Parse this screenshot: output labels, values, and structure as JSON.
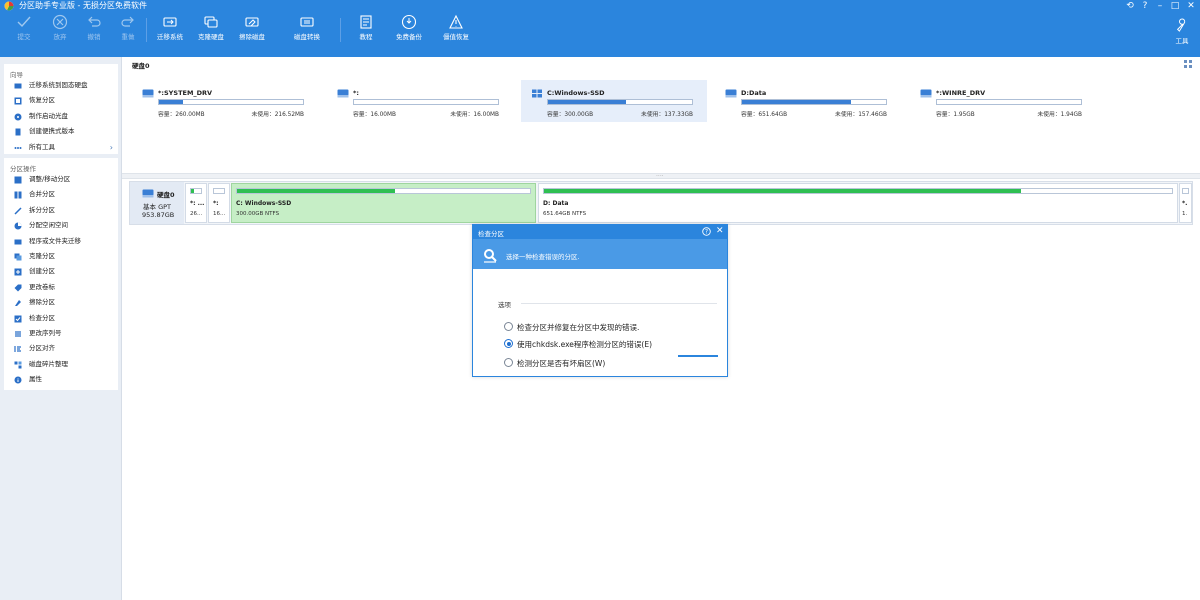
{
  "app": {
    "title": "分区助手专业版 - 无损分区免费软件",
    "window_controls": [
      "restore-icon",
      "help-icon",
      "minimize-icon",
      "maximize-icon",
      "close-icon"
    ]
  },
  "toolbar": {
    "items": [
      {
        "label": "提交",
        "icon": "check-icon",
        "enabled": false
      },
      {
        "label": "放弃",
        "icon": "cancel-icon",
        "enabled": false
      },
      {
        "label": "撤销",
        "icon": "undo-icon",
        "enabled": false
      },
      {
        "label": "重做",
        "icon": "redo-icon",
        "enabled": false
      },
      {
        "label": "迁移系统",
        "icon": "migrate-os-icon",
        "enabled": true
      },
      {
        "label": "克隆硬盘",
        "icon": "clone-disk-icon",
        "enabled": true
      },
      {
        "label": "擦除磁盘",
        "icon": "wipe-disk-icon",
        "enabled": true
      },
      {
        "label": "磁盘转换",
        "icon": "convert-disk-icon",
        "enabled": true
      },
      {
        "label": "教程",
        "icon": "tutorial-icon",
        "enabled": true
      },
      {
        "label": "免费备份",
        "icon": "backup-icon",
        "enabled": true
      },
      {
        "label": "僵值恢复",
        "icon": "recovery-icon",
        "enabled": true
      }
    ],
    "tools_label": "工具"
  },
  "sidebar": {
    "wizard_title": "向导",
    "wizard_items": [
      {
        "label": "迁移系统到固态硬盘",
        "icon": "migrate-ssd-icon"
      },
      {
        "label": "恢复分区",
        "icon": "recover-partition-icon"
      },
      {
        "label": "制作启动光盘",
        "icon": "bootable-media-icon"
      },
      {
        "label": "创建便携式版本",
        "icon": "portable-version-icon"
      },
      {
        "label": "所有工具",
        "icon": "more-tools-icon"
      }
    ],
    "ops_title": "分区操作",
    "ops_items": [
      {
        "label": "调整/移动分区",
        "icon": "resize-icon"
      },
      {
        "label": "合并分区",
        "icon": "merge-icon"
      },
      {
        "label": "拆分分区",
        "icon": "split-icon"
      },
      {
        "label": "分配空闲空间",
        "icon": "allocate-space-icon"
      },
      {
        "label": "程序或文件夹迁移",
        "icon": "app-mover-icon"
      },
      {
        "label": "克隆分区",
        "icon": "clone-partition-icon"
      },
      {
        "label": "创建分区",
        "icon": "create-partition-icon"
      },
      {
        "label": "更改卷标",
        "icon": "change-label-icon"
      },
      {
        "label": "擦除分区",
        "icon": "wipe-partition-icon"
      },
      {
        "label": "检查分区",
        "icon": "check-partition-icon"
      },
      {
        "label": "更改序列号",
        "icon": "serial-number-icon"
      },
      {
        "label": "分区对齐",
        "icon": "align-icon"
      },
      {
        "label": "磁盘碎片整理",
        "icon": "defrag-icon"
      },
      {
        "label": "属性",
        "icon": "properties-icon"
      }
    ]
  },
  "main": {
    "disk_title": "硬盘0",
    "cards": [
      {
        "name": "*:SYSTEM_DRV",
        "used": 0.17,
        "capacity": "容量：260.00MB",
        "free": "未使用：216.52MB",
        "icon": "disk-icon",
        "selected": false
      },
      {
        "name": "*:",
        "used": 0.0,
        "capacity": "容量：16.00MB",
        "free": "未使用：16.00MB",
        "icon": "disk-icon",
        "selected": false
      },
      {
        "name": "C:Windows-SSD",
        "used": 0.54,
        "capacity": "容量：300.00GB",
        "free": "未使用：137.33GB",
        "icon": "windows-icon",
        "selected": true
      },
      {
        "name": "D:Data",
        "used": 0.76,
        "capacity": "容量：651.64GB",
        "free": "未使用：157.46GB",
        "icon": "disk-icon",
        "selected": false
      },
      {
        "name": "*:WINRE_DRV",
        "used": 0.0,
        "capacity": "容量：1.95GB",
        "free": "未使用：1.94GB",
        "icon": "disk-icon",
        "selected": false
      }
    ],
    "disk_map": {
      "name": "硬盘0",
      "type": "基本 GPT",
      "size": "953.87GB",
      "partitions": [
        {
          "label": "*: ...",
          "sub": "26...",
          "used": 0.25,
          "selected": false
        },
        {
          "label": "*:",
          "sub": "16...",
          "used": 0.0,
          "selected": false
        },
        {
          "label": "C: Windows-SSD",
          "sub": "300.00GB NTFS",
          "used": 0.54,
          "selected": true
        },
        {
          "label": "D: Data",
          "sub": "651.64GB NTFS",
          "used": 0.76,
          "selected": false
        },
        {
          "label": "*.",
          "sub": "1.",
          "used": 0.0,
          "selected": false
        }
      ]
    }
  },
  "dialog": {
    "title": "检查分区",
    "hint": "选择一种检查错误的分区.",
    "section_label": "选项",
    "options": [
      {
        "label": "检查分区并修复在分区中发现的错误.",
        "checked": false
      },
      {
        "label": "使用chkdsk.exe程序检测分区的错误(E)",
        "checked": true
      },
      {
        "label": "检测分区是否有坏扇区(W)",
        "checked": false
      }
    ]
  }
}
